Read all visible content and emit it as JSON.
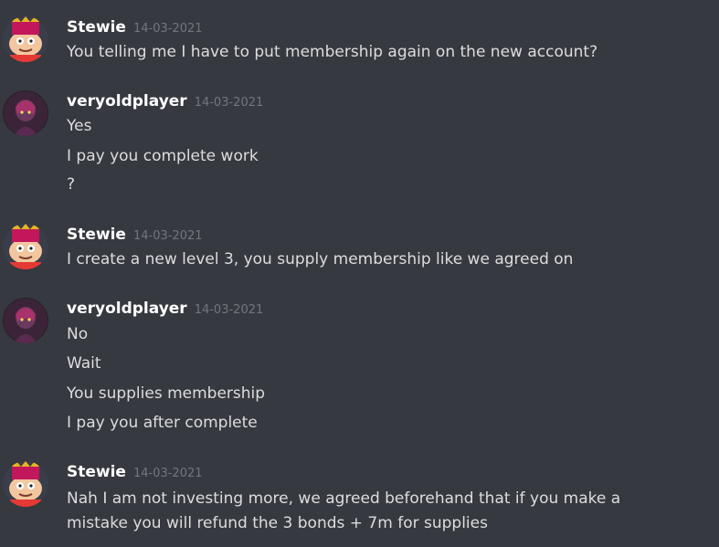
{
  "messages": [
    {
      "author": "Stewie",
      "avatar_icon": "stewie-avatar-icon",
      "timestamp": "14-03-2021",
      "lines": [
        "You telling me I have to put membership again on the new account?"
      ]
    },
    {
      "author": "veryoldplayer",
      "avatar_icon": "veryoldplayer-avatar-icon",
      "timestamp": "14-03-2021",
      "lines": [
        "Yes",
        "I pay you complete work",
        "?"
      ]
    },
    {
      "author": "Stewie",
      "avatar_icon": "stewie-avatar-icon",
      "timestamp": "14-03-2021",
      "lines": [
        "I create a new level 3, you supply membership like we agreed on"
      ]
    },
    {
      "author": "veryoldplayer",
      "avatar_icon": "veryoldplayer-avatar-icon",
      "timestamp": "14-03-2021",
      "lines": [
        "No",
        "Wait",
        "You supplies membership",
        "I pay you after complete"
      ]
    },
    {
      "author": "Stewie",
      "avatar_icon": "stewie-avatar-icon",
      "timestamp": "14-03-2021",
      "lines": [
        "Nah I am not investing more, we agreed beforehand that if you make a",
        "mistake you will refund the 3 bonds + 7m for supplies"
      ]
    }
  ],
  "colors": {
    "background": "#36393f",
    "username": "#ffffff",
    "message_text": "#dcddde",
    "timestamp": "#72767d"
  }
}
